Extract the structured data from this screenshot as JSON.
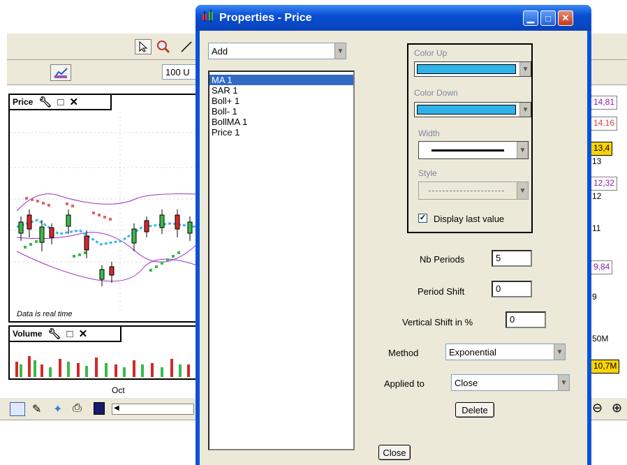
{
  "background_app": {
    "zoom_value": "100 U",
    "price_panel": {
      "title": "Price",
      "footer": "Data is real time"
    },
    "volume_panel": {
      "title": "Volume"
    },
    "x_axis": {
      "label": "Oct"
    },
    "right_scale": {
      "tags": [
        "14,81",
        "14,16",
        "13,4",
        "12,32",
        "9,84",
        "10,7M"
      ],
      "ticks": [
        "13",
        "12",
        "11",
        "9",
        "50M"
      ]
    }
  },
  "dialog": {
    "title": "Properties - Price",
    "add_combo": "Add",
    "indicator_list": [
      "MA 1",
      "SAR 1",
      "Boll+ 1",
      "Boll- 1",
      "BollMA 1",
      "Price 1"
    ],
    "selected_index": 0,
    "style_group": {
      "color_up_label": "Color Up",
      "color_down_label": "Color Down",
      "width_label": "Width",
      "style_label": "Style",
      "display_last_value_label": "Display last value",
      "display_last_value_checked": true,
      "swatch_color": "#2eb3e8"
    },
    "nb_periods_label": "Nb Periods",
    "nb_periods_value": "5",
    "period_shift_label": "Period Shift",
    "period_shift_value": "0",
    "vertical_shift_label": "Vertical Shift in %",
    "vertical_shift_value": "0",
    "method_label": "Method",
    "method_value": "Exponential",
    "applied_to_label": "Applied to",
    "applied_to_value": "Close",
    "delete_label": "Delete",
    "close_label": "Close"
  }
}
